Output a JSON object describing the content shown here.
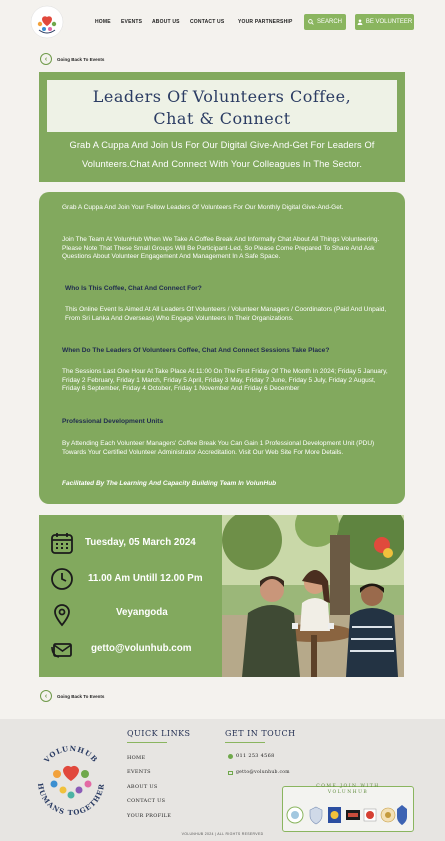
{
  "brand": {
    "logo_top_text": "VOLUNHUB",
    "logo_bottom_text": "HUMANS TOGETHER",
    "accent": "#82a95e",
    "button_green": "#8ab55f",
    "navy": "#2b3c63"
  },
  "nav": {
    "items": [
      "HOME",
      "EVENTS",
      "ABOUT US",
      "CONTACT US",
      "YOUR PARTNERSHIP"
    ],
    "search_label": "SEARCH",
    "volunteer_label": "BE VOLUNTEER"
  },
  "back_link": "Going Back To Events",
  "hero": {
    "title_line1": "Leaders Of Volunteers Coffee,",
    "title_line2": "Chat & Connect",
    "subtitle_line1": "Grab A Cuppa And Join Us For Our Digital  Give-And-Get For Leaders Of",
    "subtitle_line2": "Volunteers.Chat And Connect With Your Colleagues  In The Sector."
  },
  "description": {
    "p1": "Grab A Cuppa And Join Your Fellow Leaders Of Volunteers For Our Monthly Digital Give-And-Get.",
    "p2": "Join The Team At VolunHub When We Take A Coffee Break And Informally Chat About All Things Volunteering. Please Note That These Small Groups Will Be Participant-Led, So Please Come Prepared To Share And Ask Questions About Volunteer Engagement And Management In A Safe Space.",
    "h1": "Who Is This Coffee, Chat And Connect For?",
    "p3": "This Online Event Is Aimed At All Leaders Of Volunteers / Volunteer Managers / Coordinators (Paid And Unpaid, From Sri Lanka And Overseas) Who Engage Volunteers In Their Organizations.",
    "h2": "When Do The Leaders Of Volunteers Coffee, Chat And Connect Sessions Take Place?",
    "p4": "The Sessions Last One Hour At Take Place At 11:00 On The First Friday Of The Month In 2024; Friday 5 January, Friday 2 February, Friday 1 March, Friday 5 April, Friday 3 May, Friday 7 June, Friday 5 July, Friday 2 August, Friday 6 September, Friday 4 October, Friday 1 November And Friday 6 December",
    "h3": "Professional Development Units",
    "p5": "By Attending Each Volunteer Managers' Coffee Break You Can Gain 1 Professional Development Unit (PDU) Towards Your Certified Volunteer Administrator Accreditation. Visit Our Web Site For More Details.",
    "footer": "Facilitated By The Learning And Capacity Building Team In VolunHub"
  },
  "event_info": {
    "date": "Tuesday, 05 March 2024",
    "time": "11.00 Am Untill 12.00 Pm",
    "location": "Veyangoda",
    "email": "getto@volunhub.com"
  },
  "footer": {
    "quick_links_title": "QUICK LINKS",
    "quick_links": [
      "HOME",
      "EVENTS",
      "ABOUT US",
      "CONTACT US",
      "YOUR PROFILE"
    ],
    "get_in_touch_title": "GET IN TOUCH",
    "phone": "011 253 4568",
    "email": "getto@volunhub.com",
    "join_title_line1": "COME JOIN WITH",
    "join_title_line2": "VOLUNHUB",
    "copyright": "VOLUNHUB 2024 | ALL RIGHTS RESERVED"
  }
}
